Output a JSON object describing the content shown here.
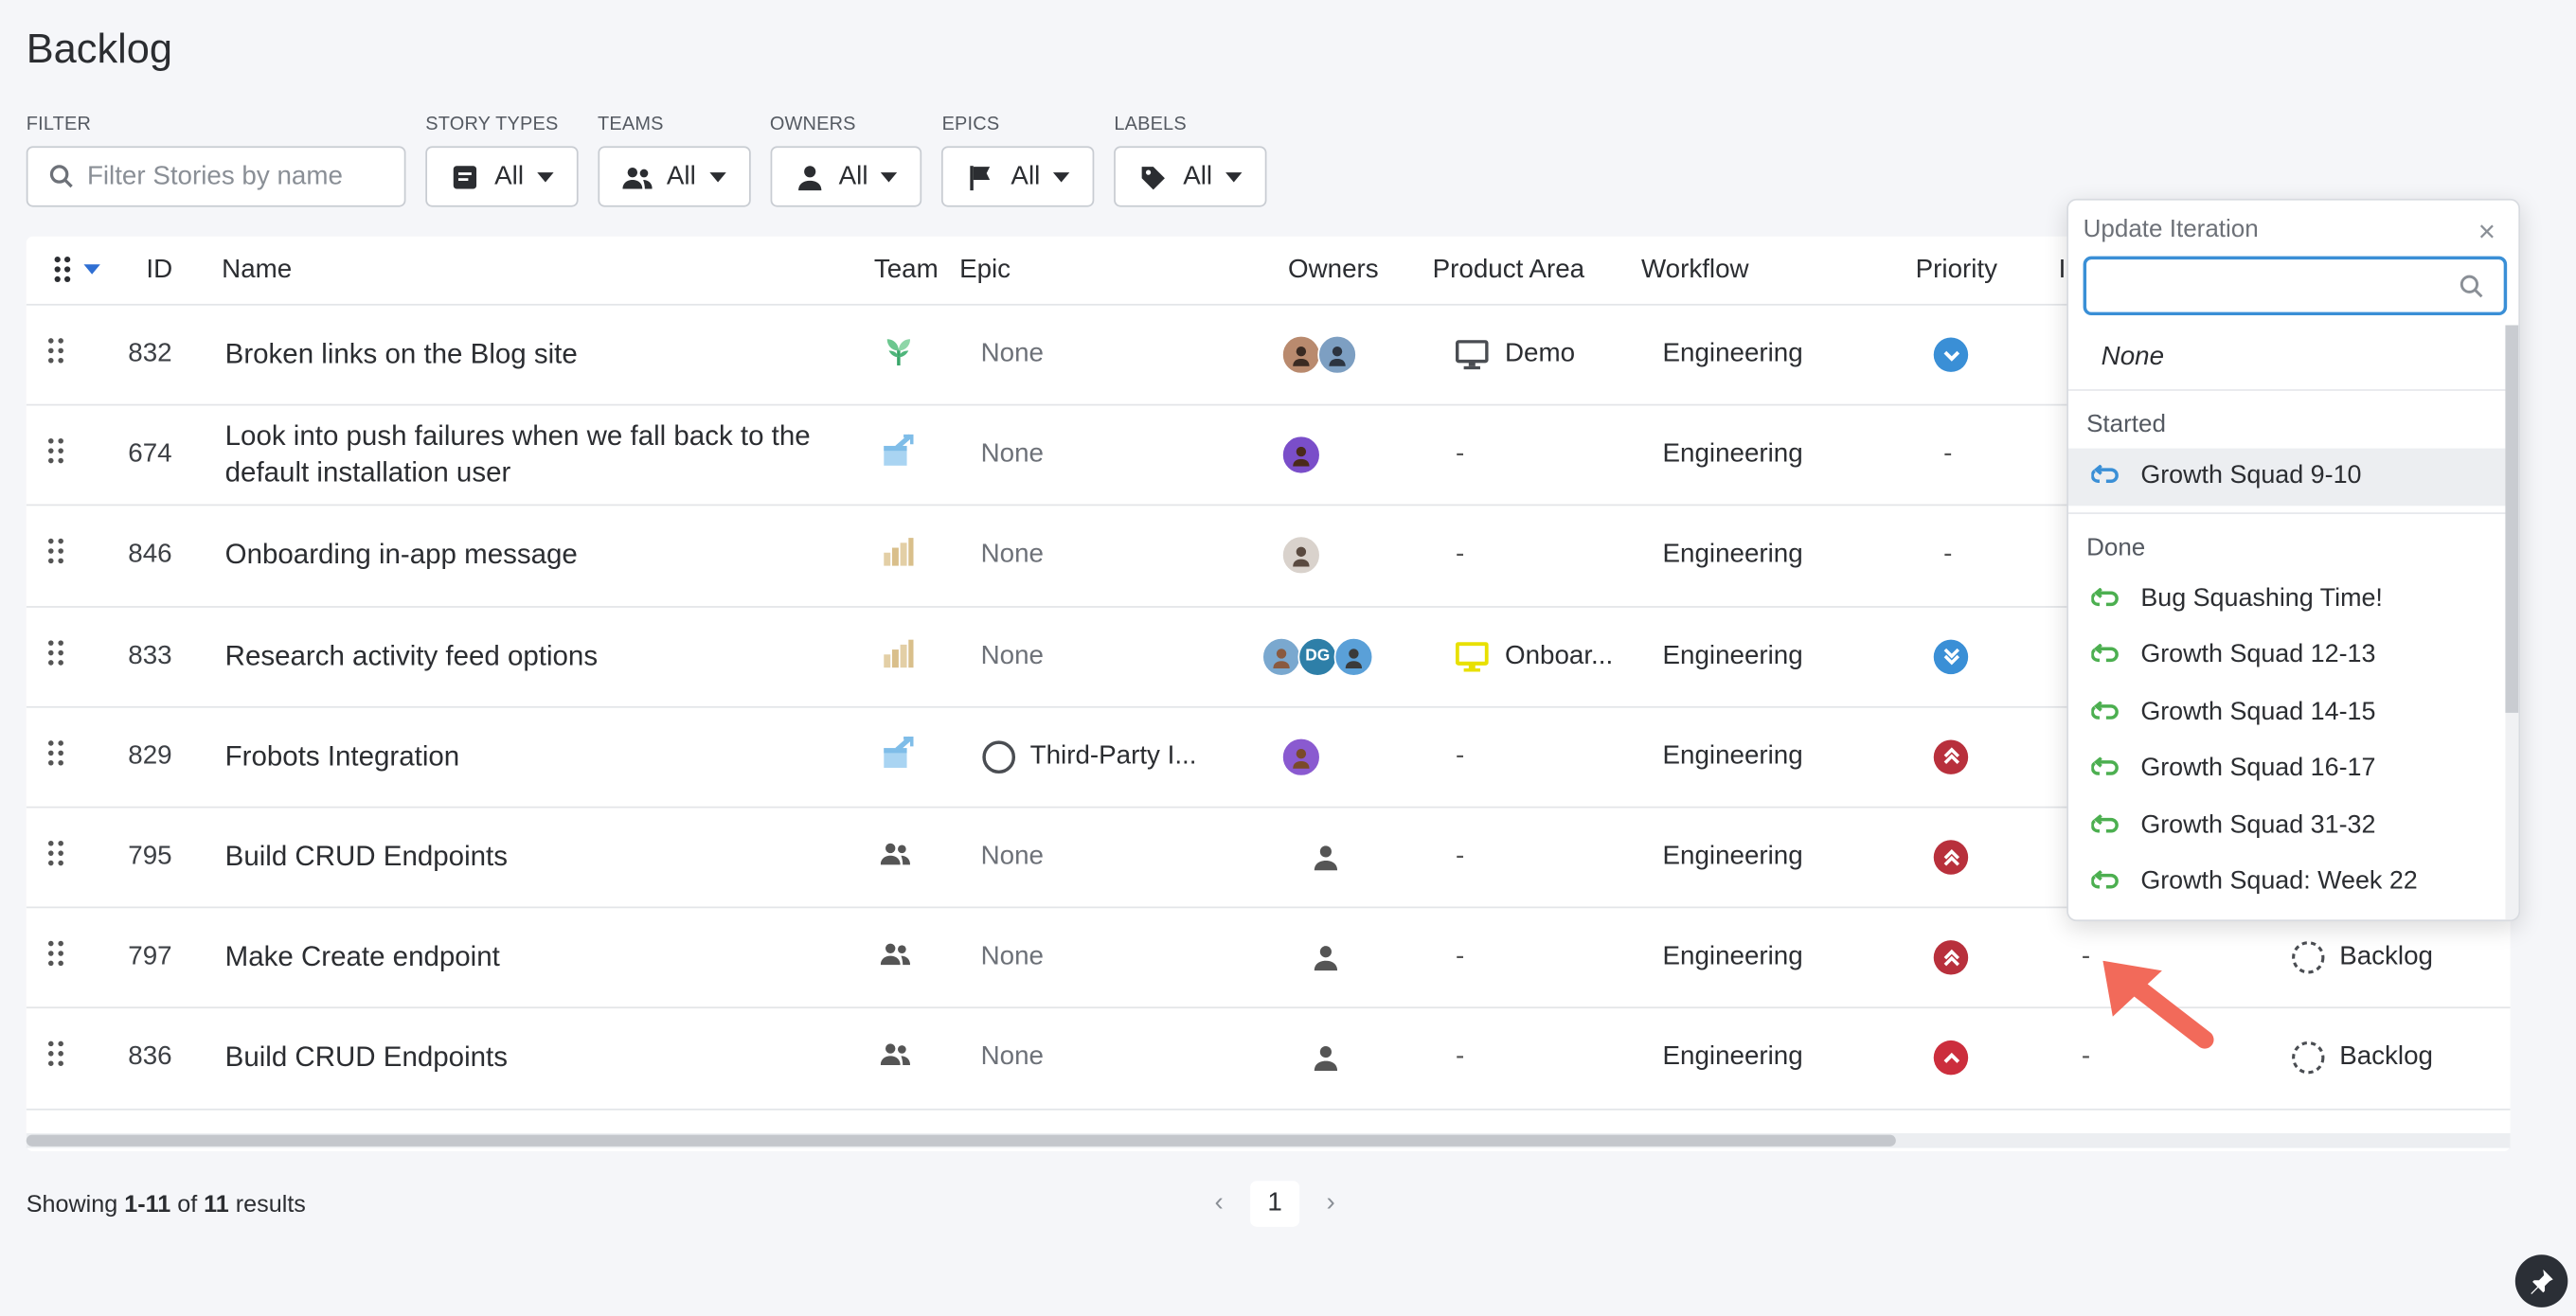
{
  "page": {
    "title": "Backlog"
  },
  "filters": {
    "filter_label": "FILTER",
    "search_placeholder": "Filter Stories by name",
    "groups": [
      {
        "label": "STORY TYPES",
        "value": "All",
        "icon": "story-type-icon"
      },
      {
        "label": "TEAMS",
        "value": "All",
        "icon": "team-icon"
      },
      {
        "label": "OWNERS",
        "value": "All",
        "icon": "person-icon"
      },
      {
        "label": "EPICS",
        "value": "All",
        "icon": "flag-icon"
      },
      {
        "label": "LABELS",
        "value": "All",
        "icon": "tag-icon"
      }
    ]
  },
  "table": {
    "columns": [
      "ID",
      "Name",
      "Team",
      "Epic",
      "Owners",
      "Product Area",
      "Workflow",
      "Priority",
      "I"
    ],
    "rows": [
      {
        "id": "832",
        "name": "Broken links on the Blog site",
        "epic": "None",
        "area": "Demo",
        "workflow": "Engineering",
        "priority": "low",
        "iteration": "",
        "state": ""
      },
      {
        "id": "674",
        "name": "Look into push failures when we fall back to the default installation user",
        "epic": "None",
        "area": "-",
        "workflow": "Engineering",
        "priority": "-",
        "iteration": "",
        "state": ""
      },
      {
        "id": "846",
        "name": "Onboarding in-app message",
        "epic": "None",
        "area": "-",
        "workflow": "Engineering",
        "priority": "-",
        "iteration": "",
        "state": ""
      },
      {
        "id": "833",
        "name": "Research activity feed options",
        "epic": "None",
        "area": "Onboar...",
        "workflow": "Engineering",
        "priority": "lowest",
        "iteration": "",
        "state": ""
      },
      {
        "id": "829",
        "name": "Frobots Integration",
        "epic": "Third-Party I...",
        "area": "-",
        "workflow": "Engineering",
        "priority": "highest",
        "iteration": "",
        "state": ""
      },
      {
        "id": "795",
        "name": "Build CRUD Endpoints",
        "epic": "None",
        "area": "-",
        "workflow": "Engineering",
        "priority": "highest",
        "iteration": "",
        "state": ""
      },
      {
        "id": "797",
        "name": "Make Create endpoint",
        "epic": "None",
        "area": "-",
        "workflow": "Engineering",
        "priority": "highest",
        "iteration": "-",
        "state": "Backlog"
      },
      {
        "id": "836",
        "name": "Build CRUD Endpoints",
        "epic": "None",
        "area": "-",
        "workflow": "Engineering",
        "priority": "high",
        "iteration": "-",
        "state": "Backlog"
      }
    ],
    "owner_initials": "DG"
  },
  "footer": {
    "showing": "Showing",
    "range": "1-11",
    "of": "of",
    "total": "11",
    "results": "results",
    "page": "1"
  },
  "dropdown": {
    "title": "Update Iteration",
    "none_label": "None",
    "started_label": "Started",
    "started_items": [
      "Growth Squad 9-10"
    ],
    "done_label": "Done",
    "done_items": [
      "Bug Squashing Time!",
      "Growth Squad 12-13",
      "Growth Squad 14-15",
      "Growth Squad 16-17",
      "Growth Squad 31-32",
      "Growth Squad: Week 22"
    ]
  },
  "colors": {
    "priority_low": "#3a8fd6",
    "priority_high": "#b8303c",
    "iteration_started": "#3a8fd6",
    "iteration_done": "#4caf50",
    "annotation_arrow": "#f26a5a"
  }
}
